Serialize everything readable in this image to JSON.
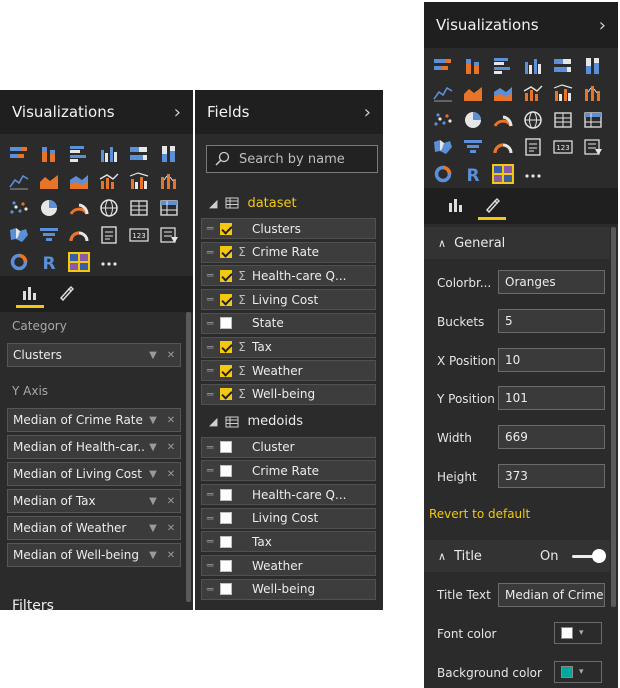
{
  "colors": {
    "accent": "#f2c811",
    "panel": "#2b2b2b",
    "font_swatch": "#ffffff",
    "bg_swatch": "#00a89d"
  },
  "left_viz": {
    "title": "Visualizations",
    "wells": {
      "category_label": "Category",
      "category_items": [
        "Clusters"
      ],
      "yaxis_label": "Y Axis",
      "yaxis_items": [
        "Median of Crime Rate",
        "Median of Health-car...",
        "Median of Living Cost",
        "Median of Tax",
        "Median of Weather",
        "Median of Well-being"
      ]
    },
    "filters_label": "Filters"
  },
  "fields": {
    "title": "Fields",
    "search_placeholder": "Search by name",
    "tables": [
      {
        "name": "dataset",
        "fields": [
          {
            "name": "Clusters",
            "checked": true,
            "sigma": false
          },
          {
            "name": "Crime Rate",
            "checked": true,
            "sigma": true
          },
          {
            "name": "Health-care Q...",
            "checked": true,
            "sigma": true
          },
          {
            "name": "Living Cost",
            "checked": true,
            "sigma": true
          },
          {
            "name": "State",
            "checked": false,
            "sigma": false
          },
          {
            "name": "Tax",
            "checked": true,
            "sigma": true
          },
          {
            "name": "Weather",
            "checked": true,
            "sigma": true
          },
          {
            "name": "Well-being",
            "checked": true,
            "sigma": true
          }
        ]
      },
      {
        "name": "medoids",
        "fields": [
          {
            "name": "Cluster",
            "checked": false,
            "sigma": false
          },
          {
            "name": "Crime Rate",
            "checked": false,
            "sigma": false
          },
          {
            "name": "Health-care Q...",
            "checked": false,
            "sigma": false
          },
          {
            "name": "Living Cost",
            "checked": false,
            "sigma": false
          },
          {
            "name": "Tax",
            "checked": false,
            "sigma": false
          },
          {
            "name": "Weather",
            "checked": false,
            "sigma": false
          },
          {
            "name": "Well-being",
            "checked": false,
            "sigma": false
          }
        ]
      }
    ]
  },
  "right_viz": {
    "title": "Visualizations",
    "general": {
      "header": "General",
      "props": [
        {
          "label": "Colorbr...",
          "value": "Oranges"
        },
        {
          "label": "Buckets",
          "value": "5"
        },
        {
          "label": "X Position",
          "value": "10"
        },
        {
          "label": "Y Position",
          "value": "101"
        },
        {
          "label": "Width",
          "value": "669"
        },
        {
          "label": "Height",
          "value": "373"
        }
      ],
      "revert": "Revert to default"
    },
    "title_section": {
      "header": "Title",
      "toggle_label": "On",
      "title_text_label": "Title Text",
      "title_text_value": "Median of Crime",
      "font_color_label": "Font color",
      "bg_color_label": "Background color"
    }
  },
  "viz_icons": [
    "stacked-bar-icon",
    "stacked-column-icon",
    "clustered-bar-icon",
    "clustered-column-icon",
    "100-bar-icon",
    "100-column-icon",
    "line-chart-icon",
    "area-chart-icon",
    "stacked-area-icon",
    "line-column-icon",
    "line-clustered-icon",
    "ribbon-chart-icon",
    "scatter-icon",
    "pie-chart-icon",
    "donut-like-icon",
    "globe-map-icon",
    "table-icon",
    "matrix-icon",
    "filled-map-icon",
    "funnel-icon",
    "gauge-icon",
    "card-icon",
    "multirow-card-icon",
    "slicer-icon",
    "donut-icon",
    "r-visual-icon",
    "custom-visual-icon",
    "more-icon"
  ]
}
